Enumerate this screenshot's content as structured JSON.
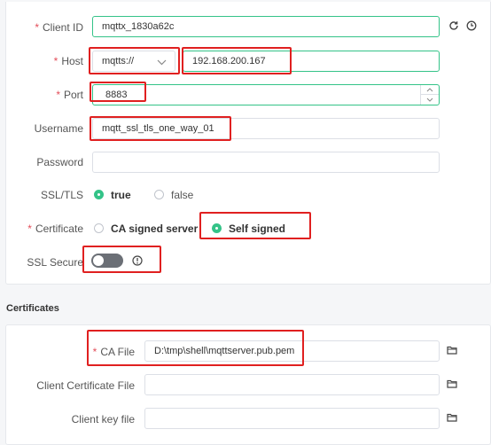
{
  "general": {
    "client_id": {
      "label": "Client ID",
      "value": "mqttx_1830a62c"
    },
    "host": {
      "label": "Host",
      "protocol": "mqtts://",
      "value": "192.168.200.167"
    },
    "port": {
      "label": "Port",
      "value": "8883"
    },
    "username": {
      "label": "Username",
      "value": "mqtt_ssl_tls_one_way_01"
    },
    "password": {
      "label": "Password",
      "value": ""
    },
    "ssl_tls": {
      "label": "SSL/TLS",
      "options": [
        "true",
        "false"
      ],
      "selected": "true"
    },
    "certificate": {
      "label": "Certificate",
      "options": [
        "CA signed server",
        "Self signed"
      ],
      "selected": "Self signed"
    },
    "ssl_secure": {
      "label": "SSL Secure",
      "enabled": false
    }
  },
  "certificates": {
    "title": "Certificates",
    "ca_file": {
      "label": "CA File",
      "value": "D:\\tmp\\shell\\mqttserver.pub.pem"
    },
    "client_cert": {
      "label": "Client Certificate File",
      "value": ""
    },
    "client_key": {
      "label": "Client key file",
      "value": ""
    }
  },
  "colors": {
    "accent": "#34c388",
    "highlight": "#e02020",
    "required": "#e34d59"
  },
  "icons": [
    "refresh-icon",
    "clock-icon",
    "chevron-down-icon",
    "spinner-up-icon",
    "spinner-down-icon",
    "info-icon",
    "folder-icon"
  ]
}
